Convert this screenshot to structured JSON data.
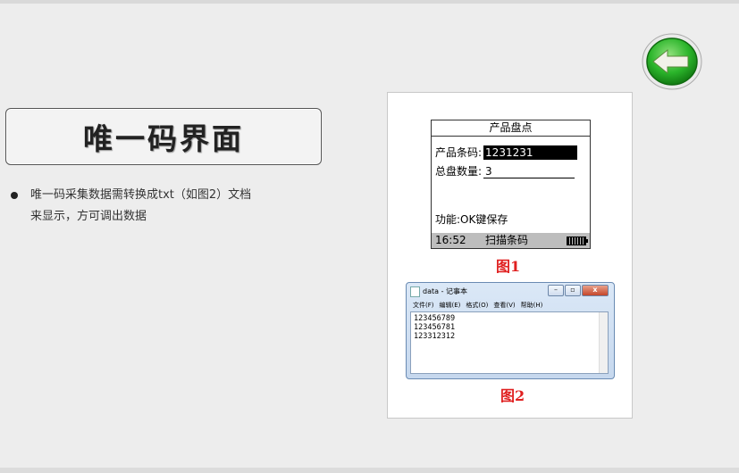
{
  "title": "唯一码界面",
  "bullet": "唯一码采集数据需转换成txt（如图2）文档\n来显示，方可调出数据",
  "device": {
    "header": "产品盘点",
    "barcode_label": "产品条码:",
    "barcode_value": "1231231",
    "count_label": "总盘数量:",
    "count_value": "3",
    "function_text": "功能:OK键保存",
    "time": "16:52",
    "scan_label": "扫描条码"
  },
  "fig1_caption": "图1",
  "notepad": {
    "title": "data - 记事本",
    "menu": [
      "文件(F)",
      "编辑(E)",
      "格式(O)",
      "查看(V)",
      "帮助(H)"
    ],
    "lines": [
      "123456789",
      "123456781",
      "123312312"
    ]
  },
  "fig2_caption": "图2",
  "colors": {
    "back_button": "#1ca31c",
    "caption": "#e02020"
  }
}
